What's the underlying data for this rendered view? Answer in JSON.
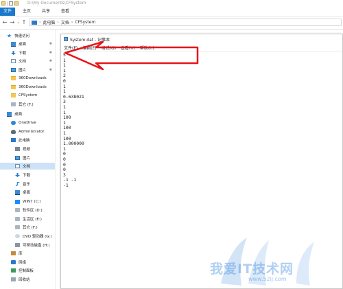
{
  "titlebar": {
    "path": "D:\\My Documents\\CFSystem"
  },
  "ribbon": {
    "tabs": [
      "文件",
      "主页",
      "共享",
      "查看"
    ]
  },
  "address": {
    "back": "←",
    "forward": "→",
    "dropdown": "⌄",
    "up": "↑",
    "crumbs": [
      "此电脑",
      "文档",
      "CFSystem"
    ]
  },
  "sidebar": {
    "items": [
      {
        "label": "快速访问",
        "icon": "star-icon"
      },
      {
        "label": "桌面",
        "icon": "desktop-icon",
        "pinned": true
      },
      {
        "label": "下载",
        "icon": "download-icon",
        "pinned": true
      },
      {
        "label": "文档",
        "icon": "document-icon",
        "pinned": true
      },
      {
        "label": "图片",
        "icon": "picture-icon",
        "pinned": true
      },
      {
        "label": "360Downloads",
        "icon": "folder-icon"
      },
      {
        "label": "360Downloads",
        "icon": "folder-icon"
      },
      {
        "label": "CFSystem",
        "icon": "folder-icon"
      },
      {
        "label": "其它 (F:)",
        "icon": "drive-icon"
      },
      {
        "label": "桌面",
        "icon": "desktop-icon"
      },
      {
        "label": "OneDrive",
        "icon": "cloud-icon"
      },
      {
        "label": "Administrator",
        "icon": "user-icon"
      },
      {
        "label": "此电脑",
        "icon": "pc-icon"
      },
      {
        "label": "视频",
        "icon": "video-icon"
      },
      {
        "label": "图片",
        "icon": "picture-icon"
      },
      {
        "label": "文档",
        "icon": "document-icon",
        "selected": true
      },
      {
        "label": "下载",
        "icon": "download-icon"
      },
      {
        "label": "音乐",
        "icon": "music-icon"
      },
      {
        "label": "桌面",
        "icon": "desktop-icon"
      },
      {
        "label": "WIN7 (C:)",
        "icon": "windows-drive-icon"
      },
      {
        "label": "软件区 (D:)",
        "icon": "drive-icon"
      },
      {
        "label": "生活区 (E:)",
        "icon": "drive-icon"
      },
      {
        "label": "其它 (F:)",
        "icon": "drive-icon"
      },
      {
        "label": "DVD 驱动器 (G:)",
        "icon": "dvd-icon"
      },
      {
        "label": "可移动磁盘 (H:)",
        "icon": "usb-icon"
      },
      {
        "label": "库",
        "icon": "library-icon"
      },
      {
        "label": "网络",
        "icon": "network-icon"
      },
      {
        "label": "控制面板",
        "icon": "control-panel-icon"
      },
      {
        "label": "回收站",
        "icon": "recycle-bin-icon"
      }
    ]
  },
  "notepad": {
    "title": "System.dat - 记事本",
    "menu": [
      "文件(F)",
      "编辑(E)",
      "格式(O)",
      "查看(V)",
      "帮助(H)"
    ],
    "lines": [
      "5",
      "1",
      "1",
      "1",
      "2",
      "0",
      "1",
      "1",
      "0.638021",
      "3",
      "1",
      "1",
      "100",
      "1",
      "100",
      "1",
      "100",
      "1.000000",
      "1",
      "0",
      "0",
      "0",
      "0",
      "3",
      "-1 -1",
      "-1"
    ]
  },
  "annotation": {
    "color": "#e8141a"
  },
  "watermark": {
    "text": "我爱IT技术网",
    "url": "www.52ij.com",
    "color": "#4f94e0"
  }
}
